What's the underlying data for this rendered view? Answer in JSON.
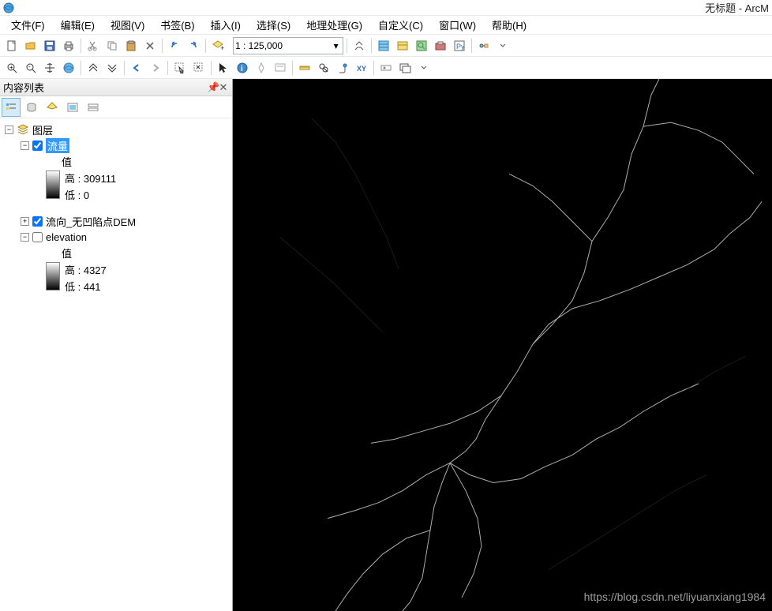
{
  "window": {
    "title": "无标题 - ArcM"
  },
  "menu": {
    "file": "文件(F)",
    "edit": "编辑(E)",
    "view": "视图(V)",
    "bookmarks": "书签(B)",
    "insert": "插入(I)",
    "selection": "选择(S)",
    "geoprocessing": "地理处理(G)",
    "customize": "自定义(C)",
    "windows": "窗口(W)",
    "help": "帮助(H)"
  },
  "toolbar": {
    "scale": "1 : 125,000"
  },
  "toc": {
    "title": "内容列表",
    "layers_label": "图层",
    "layer1": {
      "name": "流量",
      "value_label": "值",
      "high": "高 : 309111",
      "low": "低 : 0"
    },
    "layer2": {
      "name": "流向_无凹陷点DEM"
    },
    "layer3": {
      "name": "elevation",
      "value_label": "值",
      "high": "高 : 4327",
      "low": "低 : 441"
    }
  },
  "watermark": "https://blog.csdn.net/liyuanxiang1984"
}
